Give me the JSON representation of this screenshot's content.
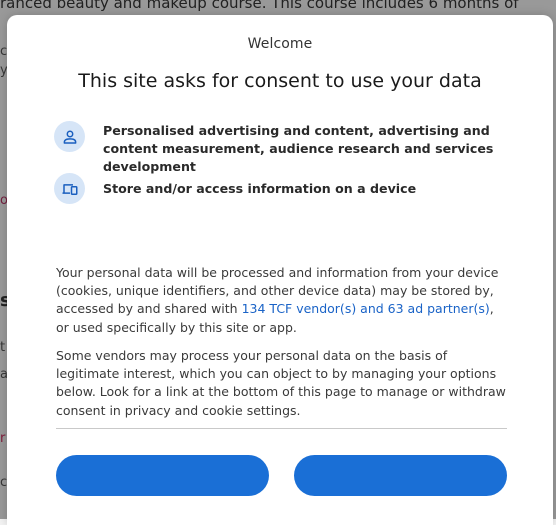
{
  "background": {
    "top_text": "ranced beauty and makeup course. This course includes 6 months of",
    "fragments": [
      {
        "text": "c",
        "cls": ""
      },
      {
        "text": "y",
        "cls": ""
      },
      {
        "text": "o",
        "cls": "red"
      },
      {
        "text": "s",
        "cls": "dark"
      },
      {
        "text": "t",
        "cls": ""
      },
      {
        "text": "a",
        "cls": ""
      },
      {
        "text": "r",
        "cls": "pink"
      },
      {
        "text": "c",
        "cls": ""
      }
    ]
  },
  "dialog": {
    "welcome": "Welcome",
    "title": "This site asks for consent to use your data",
    "purposes": [
      {
        "icon": "person-icon",
        "text": "Personalised advertising and content, advertising and content measurement, audience research and services development"
      },
      {
        "icon": "devices-icon",
        "text": "Store and/or access information on a device"
      }
    ],
    "paragraph1": {
      "before": "Your personal data will be processed and information from your device (cookies, unique identifiers, and other device data) may be stored by, accessed by and shared with ",
      "link": "134 TCF vendor(s) and 63 ad partner(s)",
      "after": ", or used specifically by this site or app."
    },
    "paragraph2": "Some vendors may process your personal data on the basis of legitimate interest, which you can object to by managing your options below. Look for a link at the bottom of this page to manage or withdraw consent in privacy and cookie settings.",
    "buttons": {
      "left_label": "",
      "right_label": ""
    },
    "colors": {
      "accent": "#1a6fd6",
      "link": "#1a63c7",
      "icon_bg": "#d6e5f7"
    }
  }
}
